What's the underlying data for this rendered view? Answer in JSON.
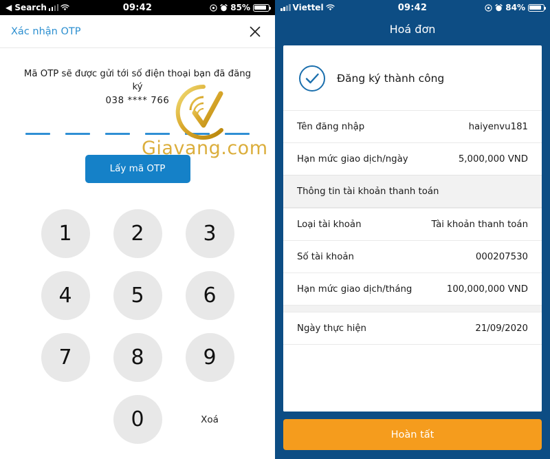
{
  "left": {
    "status": {
      "back_label": "◀ Search",
      "time": "09:42",
      "battery_pct": "85%",
      "signal_icon": "signal-bars-icon",
      "wifi_icon": "wifi-icon",
      "location_icon": "location-icon",
      "alarm_icon": "alarm-icon",
      "battery_icon": "battery-icon"
    },
    "header": {
      "title": "Xác nhận OTP",
      "close_icon": "close-icon",
      "title_color": "#2c8fd0"
    },
    "otp": {
      "note": "Mã OTP sẽ được gửi tới số điện thoại bạn đã đăng ký",
      "phone": "038 **** 766",
      "digit_count": 6,
      "dash_color": "#2f8fd4",
      "button_label": "Lấy mã OTP",
      "button_color": "#1581c8"
    },
    "keypad": {
      "keys": [
        "1",
        "2",
        "3",
        "4",
        "5",
        "6",
        "7",
        "8",
        "9"
      ],
      "zero": "0",
      "delete_label": "Xoá",
      "key_bg": "#e8e8e8"
    },
    "watermark": {
      "text": "Giavang.com",
      "color": "#d9a82c",
      "logo_icon": "giavang-check-logo-icon"
    }
  },
  "right": {
    "status": {
      "carrier": "Viettel",
      "time": "09:42",
      "battery_pct": "84%",
      "signal_icon": "signal-bars-icon",
      "wifi_icon": "wifi-icon",
      "location_icon": "location-icon",
      "alarm_icon": "alarm-icon",
      "battery_icon": "battery-icon"
    },
    "header": {
      "title": "Hoá đơn",
      "bg_color": "#0d4d84"
    },
    "success": {
      "icon": "check-circle-icon",
      "text": "Đăng ký thành công",
      "icon_color": "#1b6fad"
    },
    "rows": [
      {
        "label": "Tên đăng nhập",
        "value": "haiyenvu181",
        "type": "item"
      },
      {
        "label": "Hạn mức giao dịch/ngày",
        "value": "5,000,000 VND",
        "type": "item"
      },
      {
        "label": "Thông tin tài khoản thanh toán",
        "value": "",
        "type": "section"
      },
      {
        "label": "Loại tài khoản",
        "value": "Tài khoản thanh toán",
        "type": "item"
      },
      {
        "label": "Số tài khoản",
        "value": "000207530",
        "type": "item"
      },
      {
        "label": "Hạn mức giao dịch/tháng",
        "value": "100,000,000 VND",
        "type": "item"
      },
      {
        "label": "Ngày thực hiện",
        "value": "21/09/2020",
        "type": "item",
        "gap_before": true
      }
    ],
    "finish": {
      "label": "Hoàn tất",
      "color": "#f59c1d"
    }
  }
}
